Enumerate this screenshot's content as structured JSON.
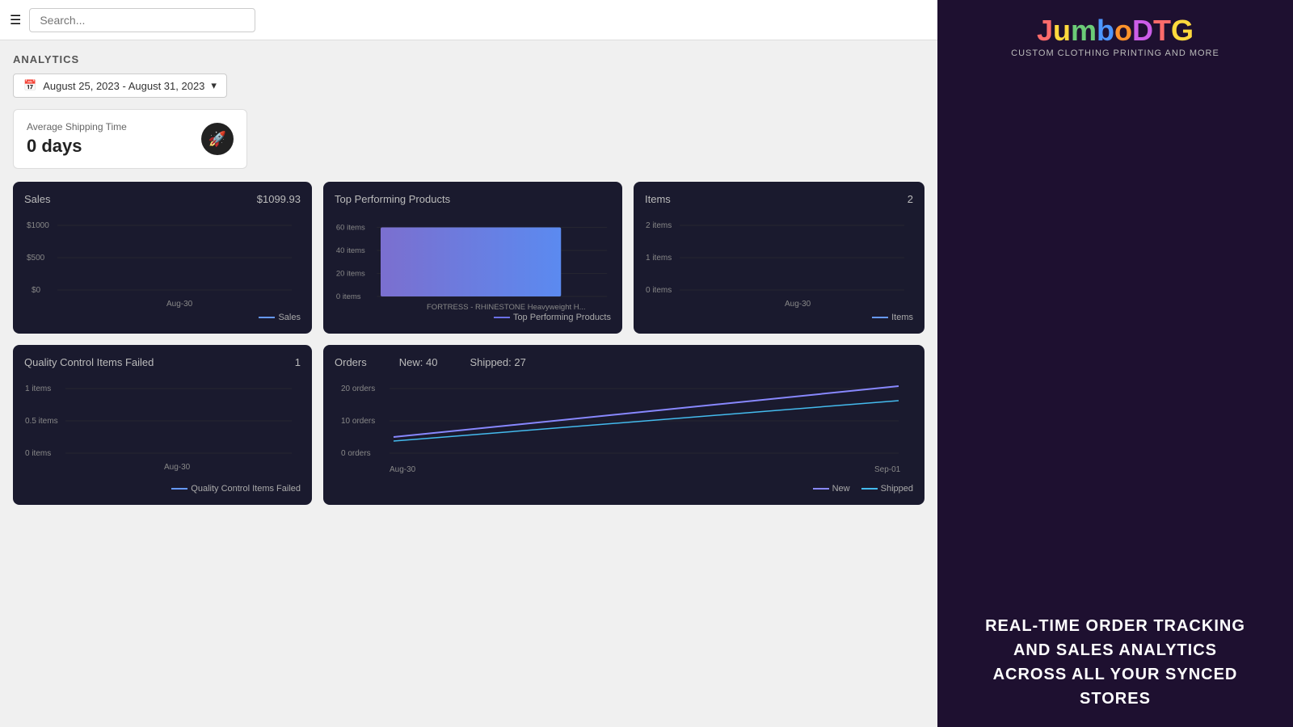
{
  "header": {
    "search_placeholder": "Search...",
    "menu_icon": "☰"
  },
  "analytics": {
    "title": "ANALYTICS",
    "date_range": "August 25, 2023 - August 31, 2023",
    "date_range_dropdown": "▾"
  },
  "avg_shipping": {
    "label": "Average Shipping Time",
    "value": "0 days",
    "icon": "🚀"
  },
  "sales_card": {
    "title": "Sales",
    "value": "$1099.93",
    "x_label": "Aug-30",
    "legend": "Sales",
    "y_labels": [
      "$1000",
      "$500",
      "$0"
    ],
    "legend_color": "#6699ff"
  },
  "top_products_card": {
    "title": "Top Performing Products",
    "bar_label": "FORTRESS - RHINESTONE Heavyweight H...",
    "y_labels": [
      "60 items",
      "40 items",
      "20 items",
      "0 items"
    ],
    "legend": "Top Performing Products",
    "legend_color": "#6b70e8"
  },
  "items_card": {
    "title": "Items",
    "value": "2",
    "x_label": "Aug-30",
    "y_labels": [
      "2 items",
      "1 items",
      "0 items"
    ],
    "legend": "Items",
    "legend_color": "#6699ff"
  },
  "qc_card": {
    "title": "Quality Control Items Failed",
    "value": "1",
    "x_label": "Aug-30",
    "y_labels": [
      "1 items",
      "0.5 items",
      "0 items"
    ],
    "legend": "Quality Control Items Failed",
    "legend_color": "#6699ff"
  },
  "orders_card": {
    "title": "Orders",
    "new_label": "New: 40",
    "shipped_label": "Shipped: 27",
    "x_start": "Aug-30",
    "x_end": "Sep-01",
    "y_labels": [
      "20 orders",
      "10 orders",
      "0 orders"
    ],
    "legend_new": "New",
    "legend_shipped": "Shipped",
    "legend_new_color": "#8888ff",
    "legend_shipped_color": "#44bbee"
  },
  "sidebar": {
    "logo_letters": [
      "J",
      "u",
      "m",
      "b",
      "o",
      "D",
      "T",
      "G"
    ],
    "subtitle": "CUSTOM CLOTHING PRINTING AND MORE",
    "tagline": "REAL-TIME ORDER TRACKING\nAND SALES ANALYTICS\nACROSS ALL YOUR SYNCED\nSTORES"
  }
}
